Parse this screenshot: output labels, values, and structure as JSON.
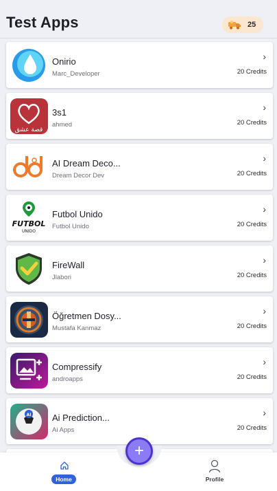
{
  "header": {
    "title": "Test Apps",
    "credits": {
      "icon": "truck-coins-icon",
      "count": "25"
    }
  },
  "apps": [
    {
      "name": "Onirio",
      "developer": "Marc_Developer",
      "price": "20 Credits",
      "icon": "water-drop-icon"
    },
    {
      "name": "3s1",
      "developer": "ahmed",
      "price": "20 Credits",
      "icon": "heart-story-icon",
      "icon_text": "قصة عشق"
    },
    {
      "name": "AI Dream Deco...",
      "developer": "Dream Decor Dev",
      "price": "20 Credits",
      "icon": "dream-decor-logo-icon"
    },
    {
      "name": "Futbol Unido",
      "developer": "Futbol Unido",
      "price": "20 Credits",
      "icon": "futbol-unido-logo-icon",
      "icon_text": "FUTBOL",
      "icon_subtext": "UNIDO"
    },
    {
      "name": "FireWall",
      "developer": "Jlabori",
      "price": "20 Credits",
      "icon": "shield-check-icon"
    },
    {
      "name": "Öğretmen Dosy...",
      "developer": "Mustafa Kanmaz",
      "price": "20 Credits",
      "icon": "teacher-emblem-icon"
    },
    {
      "name": "Compressify",
      "developer": "androapps",
      "price": "20 Credits",
      "icon": "compress-image-icon"
    },
    {
      "name": "Ai Prediction...",
      "developer": "Ai Apps",
      "price": "20 Credits",
      "icon": "ai-soccer-ball-icon",
      "icon_text": "AI"
    }
  ],
  "nav": {
    "home_label": "Home",
    "profile_label": "Profile",
    "add_symbol": "+"
  },
  "colors": {
    "background": "#eef0f5",
    "accent": "#2f64d8",
    "fab": "#8b7cf5",
    "fab_border": "#4b33d2",
    "credits_pill": "#fbe6d0"
  }
}
